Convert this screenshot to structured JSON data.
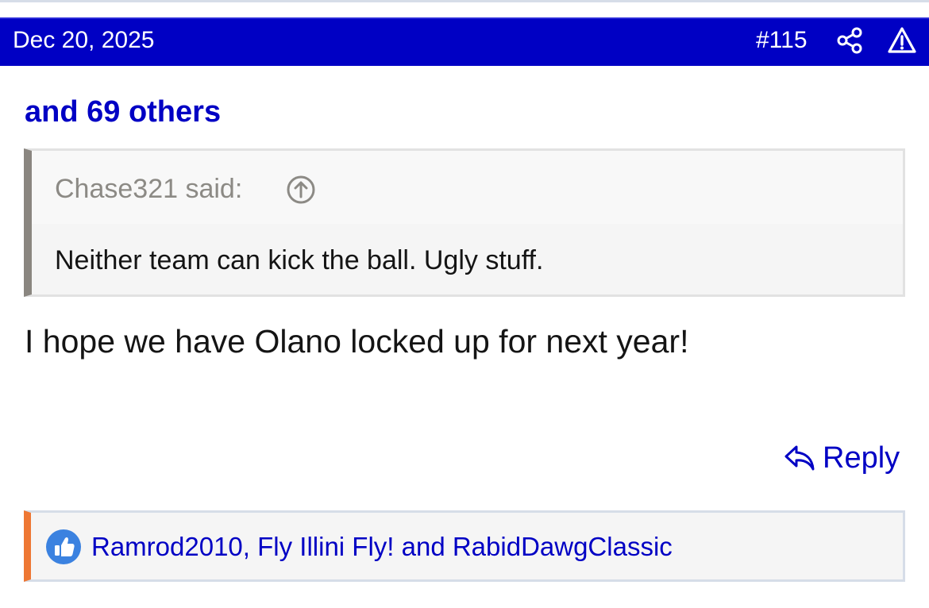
{
  "post": {
    "date": "Dec 20, 2025",
    "number": "#115",
    "others_text": "and 69 others",
    "body": "I hope we have Olano locked up for next year!"
  },
  "quote": {
    "author_said": "Chase321 said:",
    "text": "Neither team can kick the ball. Ugly stuff."
  },
  "actions": {
    "reply_label": "Reply"
  },
  "reactions": {
    "text": "Ramrod2010, Fly Illini Fly! and RabidDawgClassic"
  },
  "icons": {
    "share": "share-icon",
    "report": "warning-triangle-icon",
    "quote_jump": "arrow-up-circle-icon",
    "reply": "reply-arrow-icon",
    "like": "thumbs-up-icon"
  },
  "colors": {
    "header_bg": "#0000c4",
    "link": "#0000c4",
    "quote_border": "#8a8680",
    "reaction_accent": "#ee7733",
    "like_badge": "#3b82e0"
  }
}
